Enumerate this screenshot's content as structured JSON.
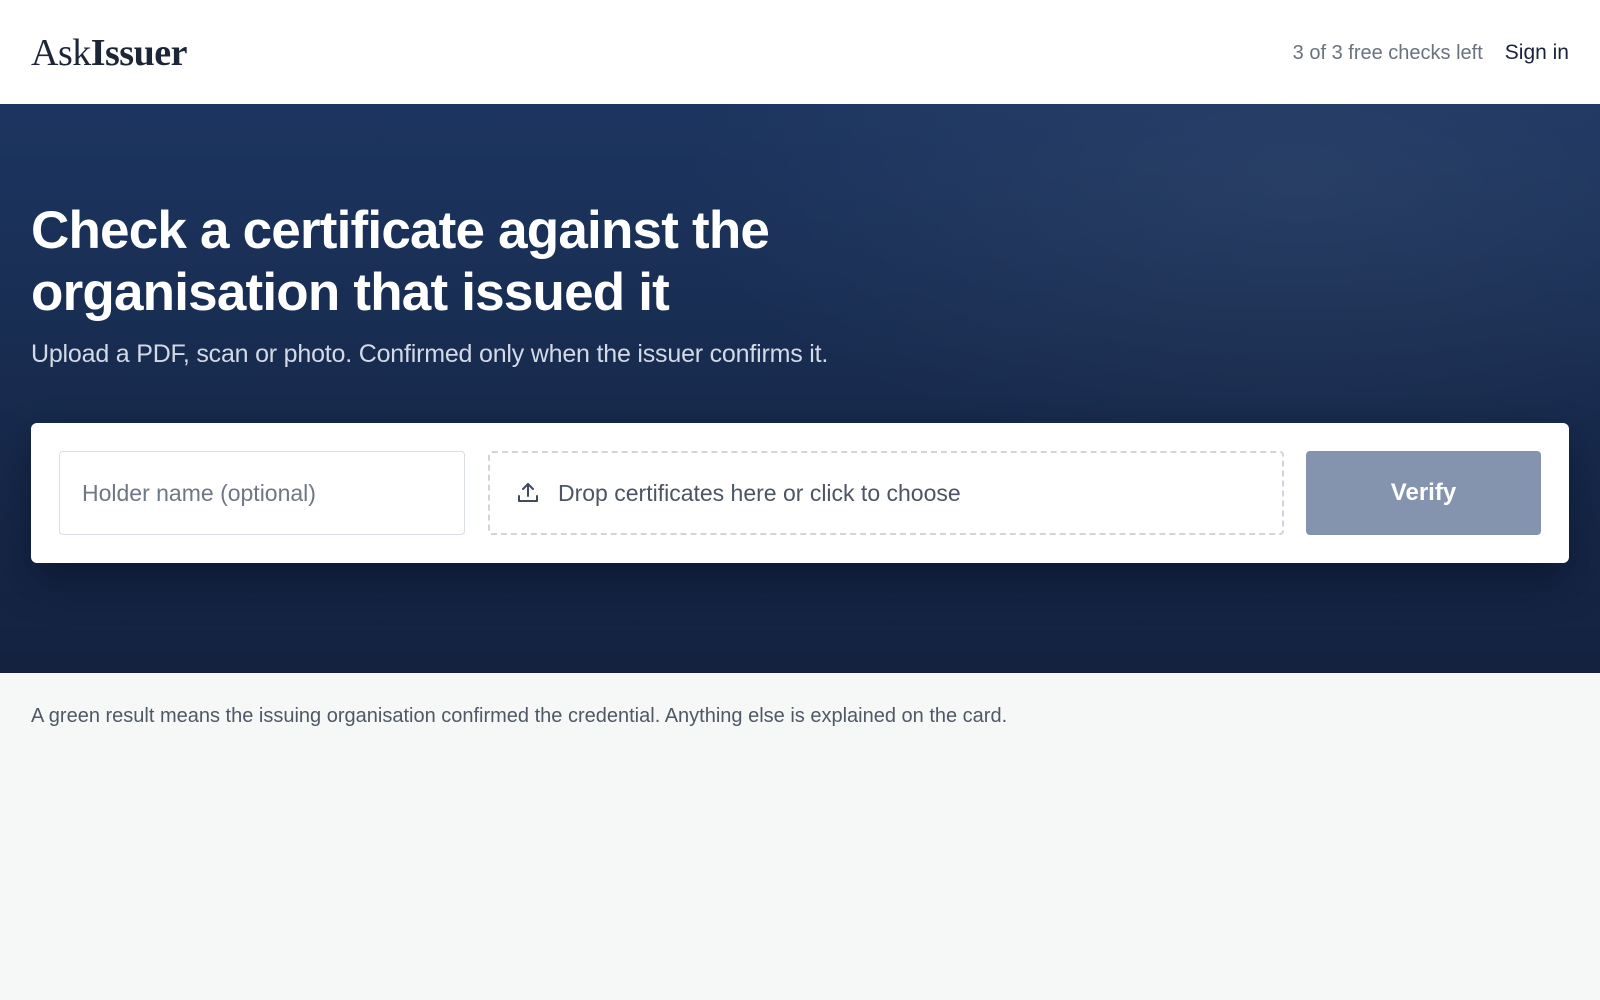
{
  "header": {
    "logo_light": "Ask",
    "logo_bold": "Issuer",
    "checks_left": "3 of 3 free checks left",
    "sign_in_label": "Sign in"
  },
  "hero": {
    "title": "Check a certificate against the organisation that issued it",
    "subtitle": "Upload a PDF, scan or photo. Confirmed only when the issuer confirms it."
  },
  "upload_form": {
    "holder_name_placeholder": "Holder name (optional)",
    "holder_name_value": "",
    "dropzone_label": "Drop certificates here or click to choose",
    "dropzone_icon": "upload-icon",
    "verify_label": "Verify"
  },
  "info_note": "A green result means the issuing organisation confirmed the credential. Anything else is explained on the card.",
  "colors": {
    "hero_background": "#1a2f57",
    "verify_button": "#8594ae",
    "page_background": "#f6f8f7"
  }
}
